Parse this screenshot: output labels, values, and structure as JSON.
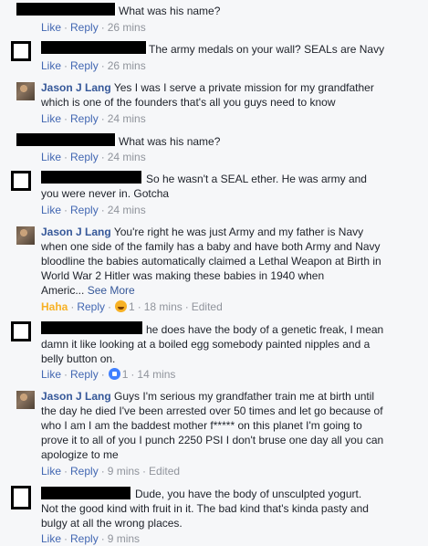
{
  "comments": [
    {
      "text": "What was his name?",
      "like": "Like",
      "reply": "Reply",
      "time": "26 mins"
    },
    {
      "text": "The army medals on your wall? SEALs are Navy",
      "like": "Like",
      "reply": "Reply",
      "time": "26 mins"
    },
    {
      "author": "Jason J Lang",
      "text_lines": [
        "Yes I was I serve a private mission for my grandfather",
        "which is one of the founders that's all you guys need to know"
      ],
      "like": "Like",
      "reply": "Reply",
      "time": "24 mins"
    },
    {
      "text": "What was his name?",
      "like": "Like",
      "reply": "Reply",
      "time": "24 mins"
    },
    {
      "text_lines": [
        "So he wasn't a SEAL ether. He was army and",
        "you were never in. Gotcha"
      ],
      "like": "Like",
      "reply": "Reply",
      "time": "24 mins"
    },
    {
      "author": "Jason J Lang",
      "text_lines": [
        "You're right he was just Army and my father is Navy",
        "when one side of the family has a baby and have both Army and Navy",
        "bloodline the babies automatically claimed a Lethal Weapon at Birth in",
        "World War 2 Hitler was making these babies in 1940 when",
        "Americ..."
      ],
      "see_more": "See More",
      "reaction": "Haha",
      "reply": "Reply",
      "reaction_count": "1",
      "time": "18 mins",
      "edited": "Edited"
    },
    {
      "text_lines": [
        "he does have the body of a genetic freak, I mean",
        "damn it like looking at a boiled egg somebody painted nipples and a",
        "belly button on."
      ],
      "like": "Like",
      "reply": "Reply",
      "reaction_count": "1",
      "time": "14 mins"
    },
    {
      "author": "Jason J Lang",
      "text_lines": [
        "Guys I'm serious my grandfather train me at birth until",
        "the day he died I've been arrested over 50 times and let go because of",
        "who I am I am the baddest mother f***** on this planet I'm going to",
        "prove it to all of you I punch 2250 PSI I don't bruse one day all you can",
        "apologize to me"
      ],
      "like": "Like",
      "reply": "Reply",
      "time": "9 mins",
      "edited": "Edited"
    },
    {
      "text_lines": [
        "Dude, you have the body of unsculpted yogurt.",
        "Not the good kind with fruit in it. The bad kind that's kinda pasty and",
        "bulgy at all the wrong places."
      ],
      "like": "Like",
      "reply": "Reply",
      "time": "9 mins"
    }
  ]
}
